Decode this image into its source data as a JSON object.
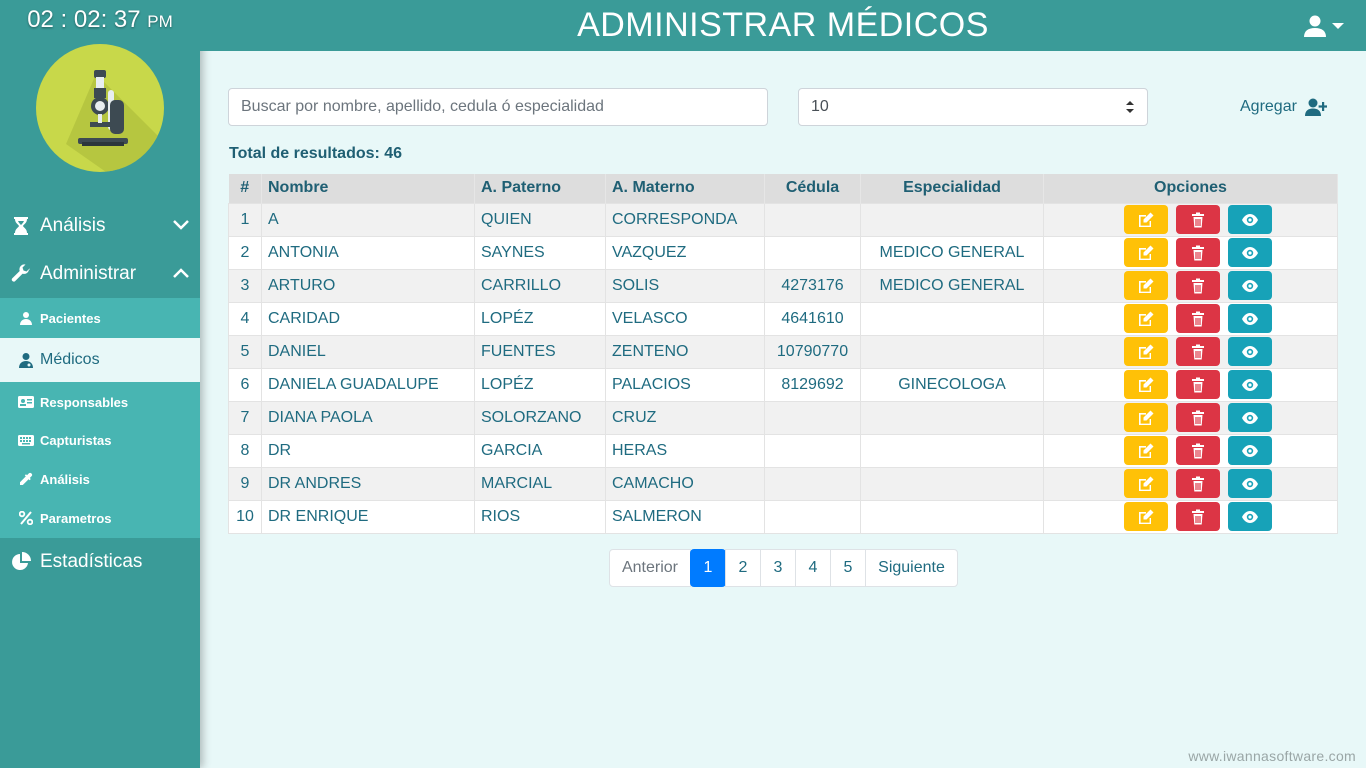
{
  "clock": {
    "time": "02 : 02: 37",
    "ampm": "PM"
  },
  "header": {
    "title": "ADMINISTRAR MÉDICOS",
    "user_icon": "user-icon"
  },
  "sidebar": {
    "analisis": "Análisis",
    "administrar": "Administrar",
    "estadisticas": "Estadísticas",
    "submenu": [
      {
        "label": "Pacientes",
        "icon": "users-icon"
      },
      {
        "label": "Médicos",
        "icon": "doctor-icon",
        "active": true
      },
      {
        "label": "Responsables",
        "icon": "id-card-icon"
      },
      {
        "label": "Capturistas",
        "icon": "keyboard-icon"
      },
      {
        "label": "Análisis",
        "icon": "eyedropper-icon"
      },
      {
        "label": "Parametros",
        "icon": "percent-icon"
      }
    ]
  },
  "toolbar": {
    "search_placeholder": "Buscar por nombre, apellido, cedula ó especialidad",
    "page_size": "10",
    "add_label": "Agregar"
  },
  "total": "Total de resultados: 46",
  "table": {
    "headers": [
      "#",
      "Nombre",
      "A. Paterno",
      "A. Materno",
      "Cédula",
      "Especialidad",
      "Opciones"
    ],
    "rows": [
      [
        "1",
        "A",
        "QUIEN",
        "CORRESPONDA",
        "",
        ""
      ],
      [
        "2",
        "ANTONIA",
        "SAYNES",
        "VAZQUEZ",
        "",
        "MEDICO GENERAL"
      ],
      [
        "3",
        "ARTURO",
        "CARRILLO",
        "SOLIS",
        "4273176",
        "MEDICO GENERAL"
      ],
      [
        "4",
        "CARIDAD",
        "LOPÉZ",
        "VELASCO",
        "4641610",
        ""
      ],
      [
        "5",
        "DANIEL",
        "FUENTES",
        "ZENTENO",
        "10790770",
        ""
      ],
      [
        "6",
        "DANIELA GUADALUPE",
        "LOPÉZ",
        "PALACIOS",
        "8129692",
        "GINECOLOGA"
      ],
      [
        "7",
        "DIANA PAOLA",
        "SOLORZANO",
        "CRUZ",
        "",
        ""
      ],
      [
        "8",
        "DR",
        "GARCIA",
        "HERAS",
        "",
        ""
      ],
      [
        "9",
        "DR ANDRES",
        "MARCIAL",
        "CAMACHO",
        "",
        ""
      ],
      [
        "10",
        "DR ENRIQUE",
        "RIOS",
        "SALMERON",
        "",
        ""
      ]
    ]
  },
  "pagination": {
    "prev": "Anterior",
    "pages": [
      "1",
      "2",
      "3",
      "4",
      "5"
    ],
    "current": "1",
    "next": "Siguiente"
  },
  "footer": "www.iwannasoftware.com",
  "colors": {
    "teal": "#3a9b98",
    "submenu": "#48b5b2",
    "edit": "#ffc107",
    "delete": "#dc3545",
    "view": "#17a2b8",
    "active_page": "#007bff"
  }
}
